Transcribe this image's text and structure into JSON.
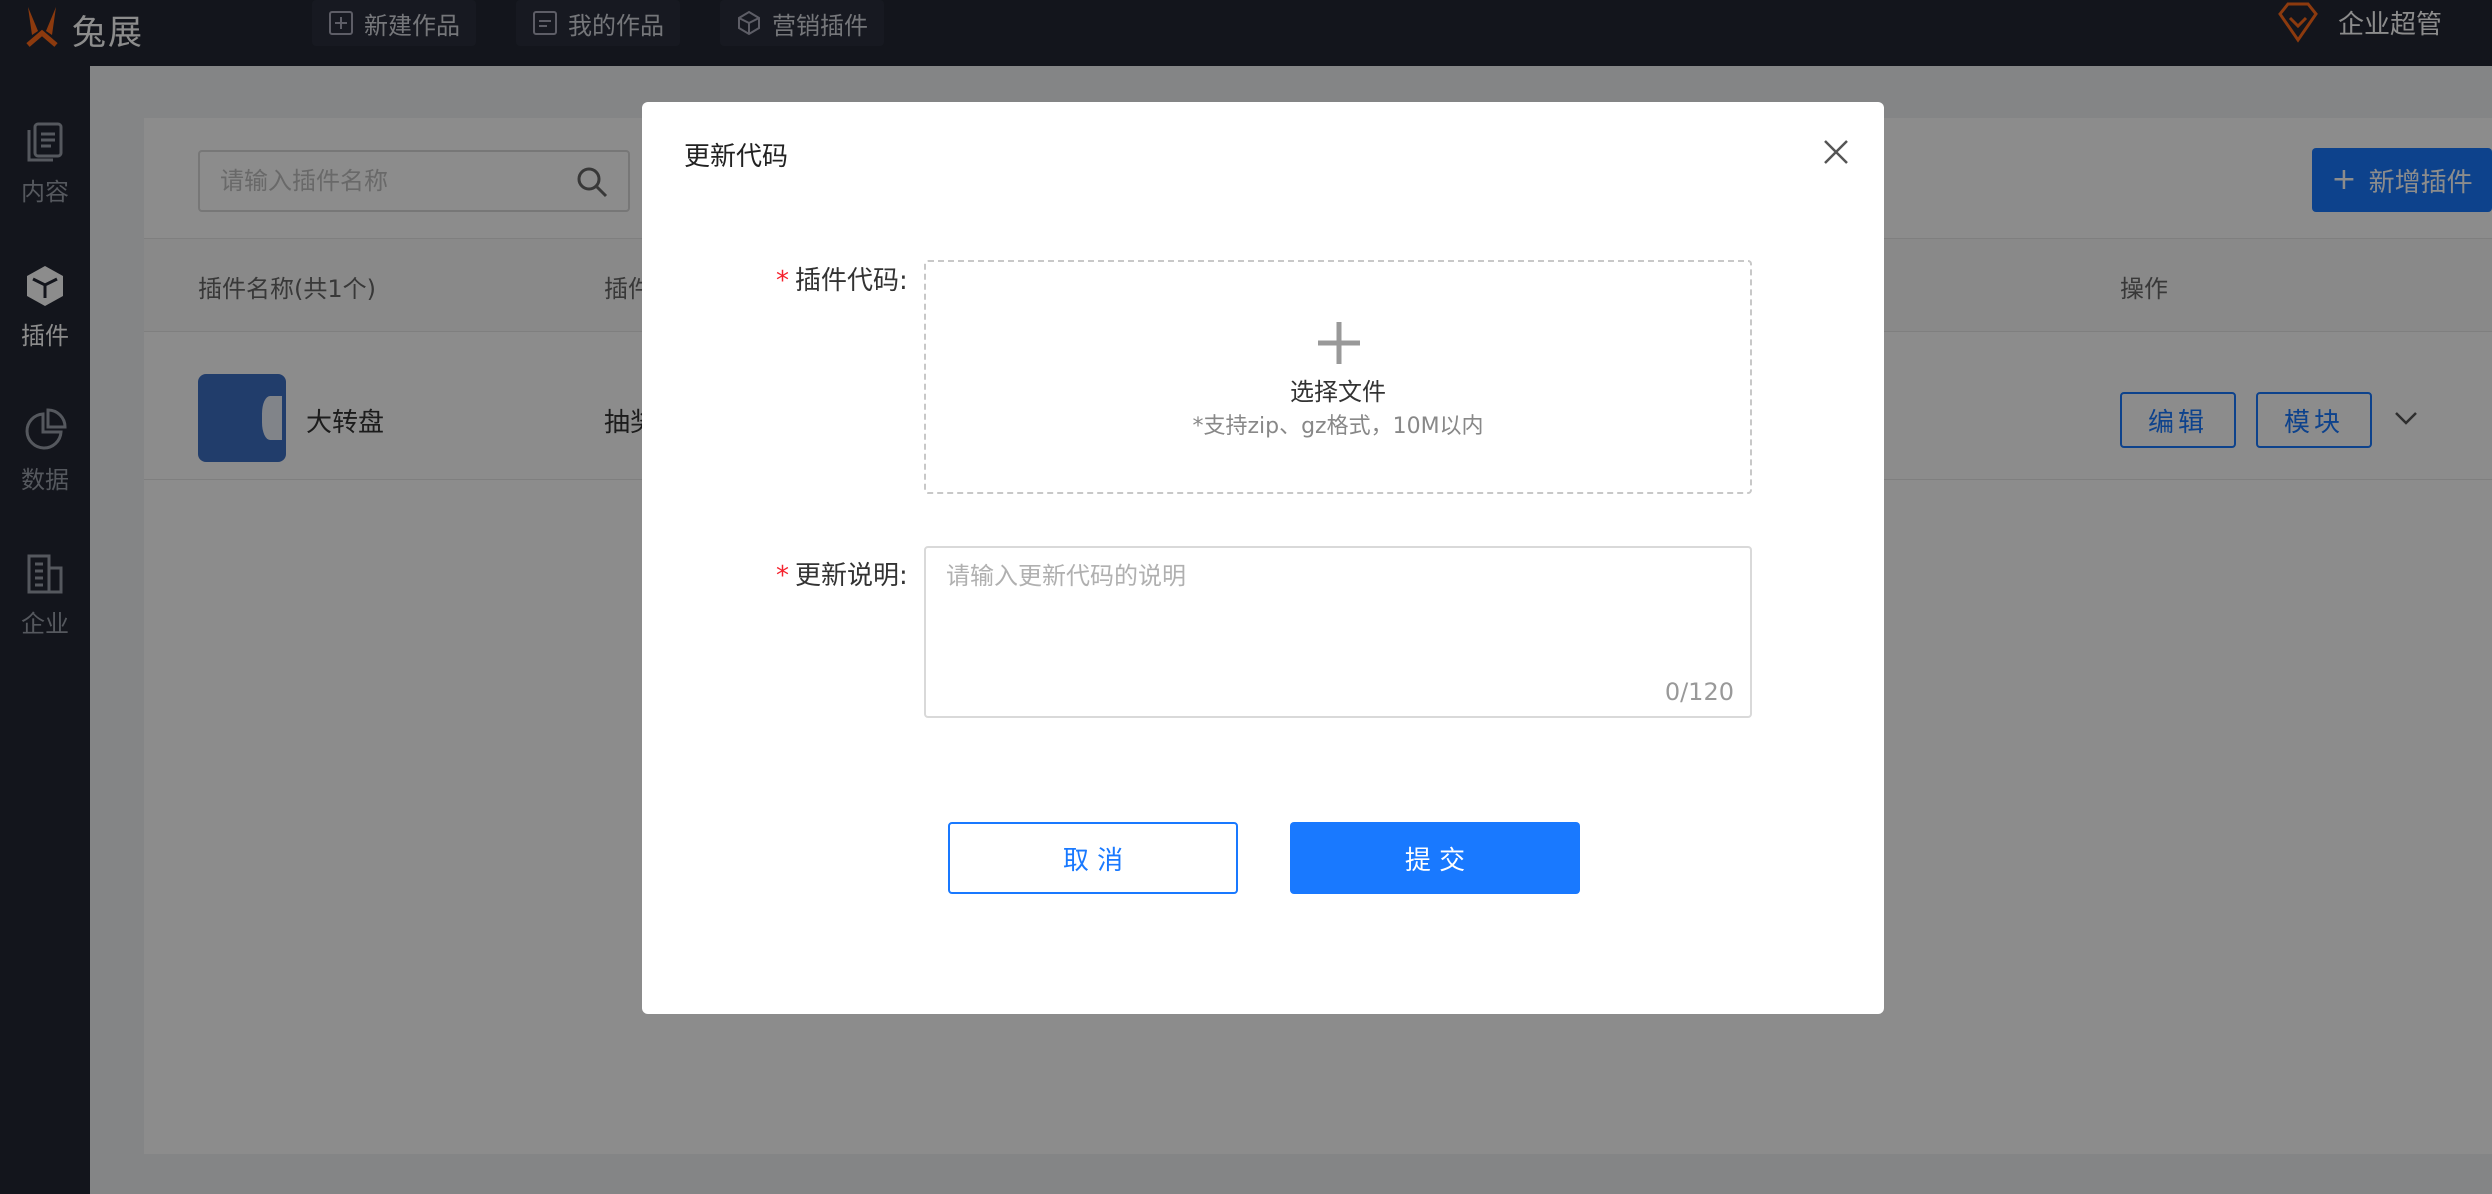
{
  "app": {
    "name": "兔展"
  },
  "topnav": {
    "items": [
      {
        "label": "新建作品",
        "icon": "plus-square-icon"
      },
      {
        "label": "我的作品",
        "icon": "minus-square-icon"
      },
      {
        "label": "营销插件",
        "icon": "hexagon-icon"
      }
    ]
  },
  "user": {
    "name": "企业超管",
    "icon": "diamond-icon"
  },
  "sidebar": {
    "items": [
      {
        "label": "内容",
        "icon": "copy-icon"
      },
      {
        "label": "插件",
        "icon": "cube-icon"
      },
      {
        "label": "数据",
        "icon": "pie-chart-icon"
      },
      {
        "label": "企业",
        "icon": "building-icon"
      }
    ]
  },
  "main": {
    "search_placeholder": "请输入插件名称",
    "add_button": "新增插件",
    "table": {
      "headers": {
        "name": "插件名称(共1个)",
        "type": "插件",
        "actions": "操作"
      },
      "rows": [
        {
          "name": "大转盘",
          "type": "抽奖",
          "edit": "编辑",
          "module": "模块"
        }
      ]
    }
  },
  "modal": {
    "title": "更新代码",
    "code_label": "插件代码:",
    "upload_title": "选择文件",
    "upload_hint": "*支持zip、gz格式，10M以内",
    "desc_label": "更新说明:",
    "desc_placeholder": "请输入更新代码的说明",
    "desc_count": "0/120",
    "cancel": "取 消",
    "submit": "提 交"
  },
  "colors": {
    "accent": "#1979ff",
    "topbar": "#232733",
    "required": "#f5222d"
  }
}
